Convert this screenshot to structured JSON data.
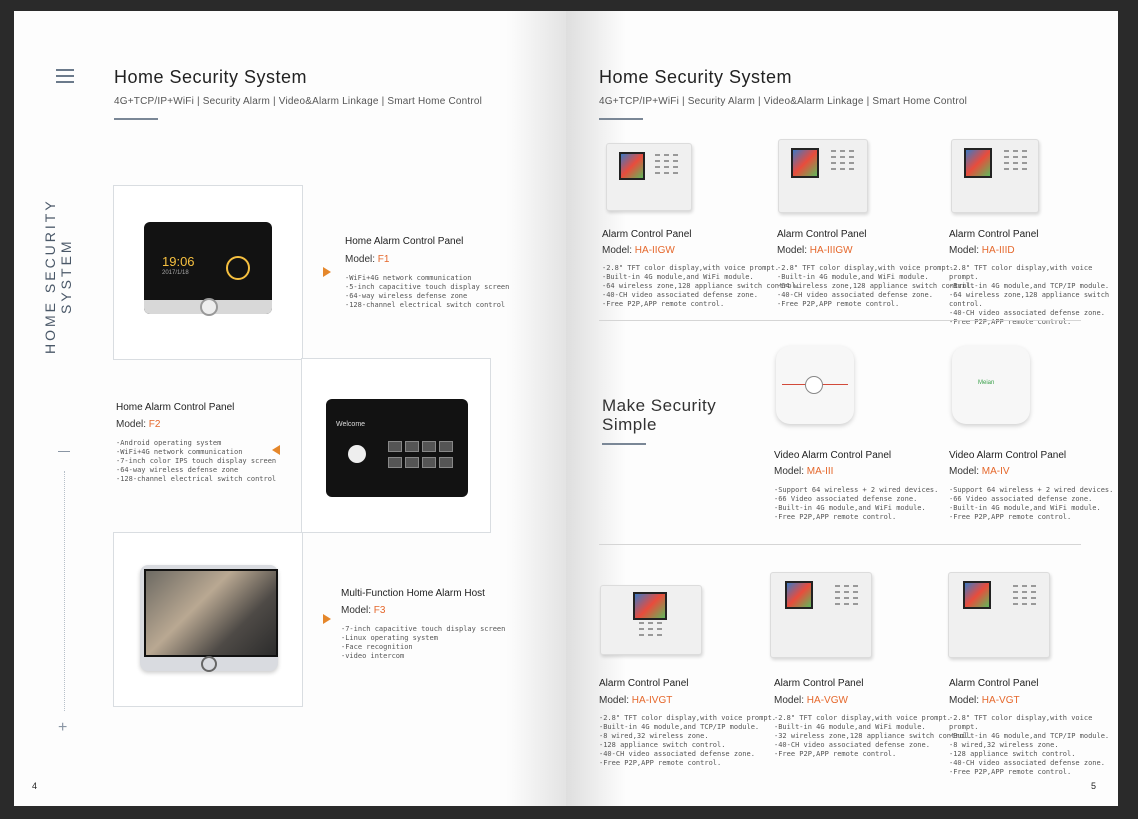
{
  "header": {
    "title": "Home Security System",
    "subtitle": "4G+TCP/IP+WiFi | Security Alarm | Video&Alarm Linkage | Smart Home Control"
  },
  "left": {
    "vertical_label": "HOME  SECURITY  SYSTEM",
    "page_number": "4",
    "plus": "+",
    "devices": {
      "f1": {
        "time": "19:06",
        "date": "2017/1/18"
      },
      "f2": {
        "welcome": "Welcome"
      }
    },
    "products": [
      {
        "title": "Home Alarm Control Panel",
        "model_label": "Model: ",
        "model": "F1",
        "features": [
          "-WiFi+4G network communication",
          "-5-inch capacitive touch display screen",
          "-64-way wireless defense zone",
          "-128-channel electrical switch control"
        ]
      },
      {
        "title": "Home Alarm Control Panel",
        "model_label": "Model: ",
        "model": "F2",
        "features": [
          "-Android operating system",
          "-WiFi+4G network communication",
          "-7-inch color IPS touch display screen",
          "-64-way wireless defense zone",
          "-128-channel electrical switch control"
        ]
      },
      {
        "title": "Multi-Function Home Alarm Host",
        "model_label": "Model: ",
        "model": "F3",
        "features": [
          "-7-inch capacitive touch display screen",
          "-Linux operating system",
          "-Face recognition",
          "-video intercom"
        ]
      }
    ]
  },
  "right": {
    "page_number": "5",
    "slogan_line1": "Make Security",
    "slogan_line2": "Simple",
    "hub_brand": "Meian",
    "products": [
      {
        "title": "Alarm Control Panel",
        "model_label": "Model: ",
        "model": "HA-IIGW",
        "features": [
          "-2.8\" TFT color display,with voice prompt.",
          "-Built-in 4G module,and WiFi module.",
          "-64 wireless zone,128 appliance switch control.",
          "-40-CH video associated defense zone.",
          "-Free P2P,APP remote control."
        ]
      },
      {
        "title": "Alarm Control Panel",
        "model_label": "Model: ",
        "model": "HA-IIIGW",
        "features": [
          "-2.8\" TFT color display,with voice prompt.",
          "-Built-in 4G module,and WiFi module.",
          "-64 wireless zone,128 appliance switch control.",
          "-40-CH video associated defense zone.",
          "-Free P2P,APP remote control."
        ]
      },
      {
        "title": "Alarm Control Panel",
        "model_label": "Model: ",
        "model": "HA-IIID",
        "features": [
          "-2.8\" TFT color display,with voice prompt.",
          "-Built-in 4G module,and TCP/IP module.",
          "-64 wireless zone,128 appliance switch control.",
          "-40-CH video associated defense zone.",
          "-Free P2P,APP remote control."
        ]
      },
      {
        "title": "Video Alarm Control Panel",
        "model_label": "Model: ",
        "model": "MA-III",
        "features": [
          "-Support 64 wireless + 2 wired devices.",
          "-66 Video associated defense zone.",
          "-Built-in 4G module,and WiFi module.",
          "-Free P2P,APP remote control."
        ]
      },
      {
        "title": "Video Alarm Control Panel",
        "model_label": "Model: ",
        "model": "MA-IV",
        "features": [
          "-Support 64 wireless + 2 wired devices.",
          "-66 Video associated defense zone.",
          "-Built-in 4G module,and WiFi module.",
          "-Free P2P,APP remote control."
        ]
      },
      {
        "title": "Alarm Control Panel",
        "model_label": "Model: ",
        "model": "HA-IVGT",
        "features": [
          "-2.8\" TFT color display,with voice prompt.",
          "-Built-in 4G module,and TCP/IP module.",
          "-8 wired,32 wireless zone.",
          "-128 appliance switch control.",
          "-40-CH video associated defense zone.",
          "-Free P2P,APP remote control."
        ]
      },
      {
        "title": "Alarm Control Panel",
        "model_label": "Model: ",
        "model": "HA-VGW",
        "features": [
          "-2.8\" TFT color display,with voice prompt.",
          "-Built-in 4G module,and WiFi module.",
          "-32 wireless zone,128 appliance switch control.",
          "-40-CH video associated defense zone.",
          "-Free P2P,APP remote control."
        ]
      },
      {
        "title": "Alarm Control Panel",
        "model_label": "Model: ",
        "model": "HA-VGT",
        "features": [
          "-2.8\" TFT color display,with voice prompt.",
          "-Built-in 4G module,and TCP/IP module.",
          "-8 wired,32 wireless zone.",
          "-128 appliance switch control.",
          "-40-CH video associated defense zone.",
          "-Free P2P,APP remote control."
        ]
      }
    ]
  },
  "colors": {
    "accent": "#e5672b",
    "rule": "#7a8796"
  }
}
